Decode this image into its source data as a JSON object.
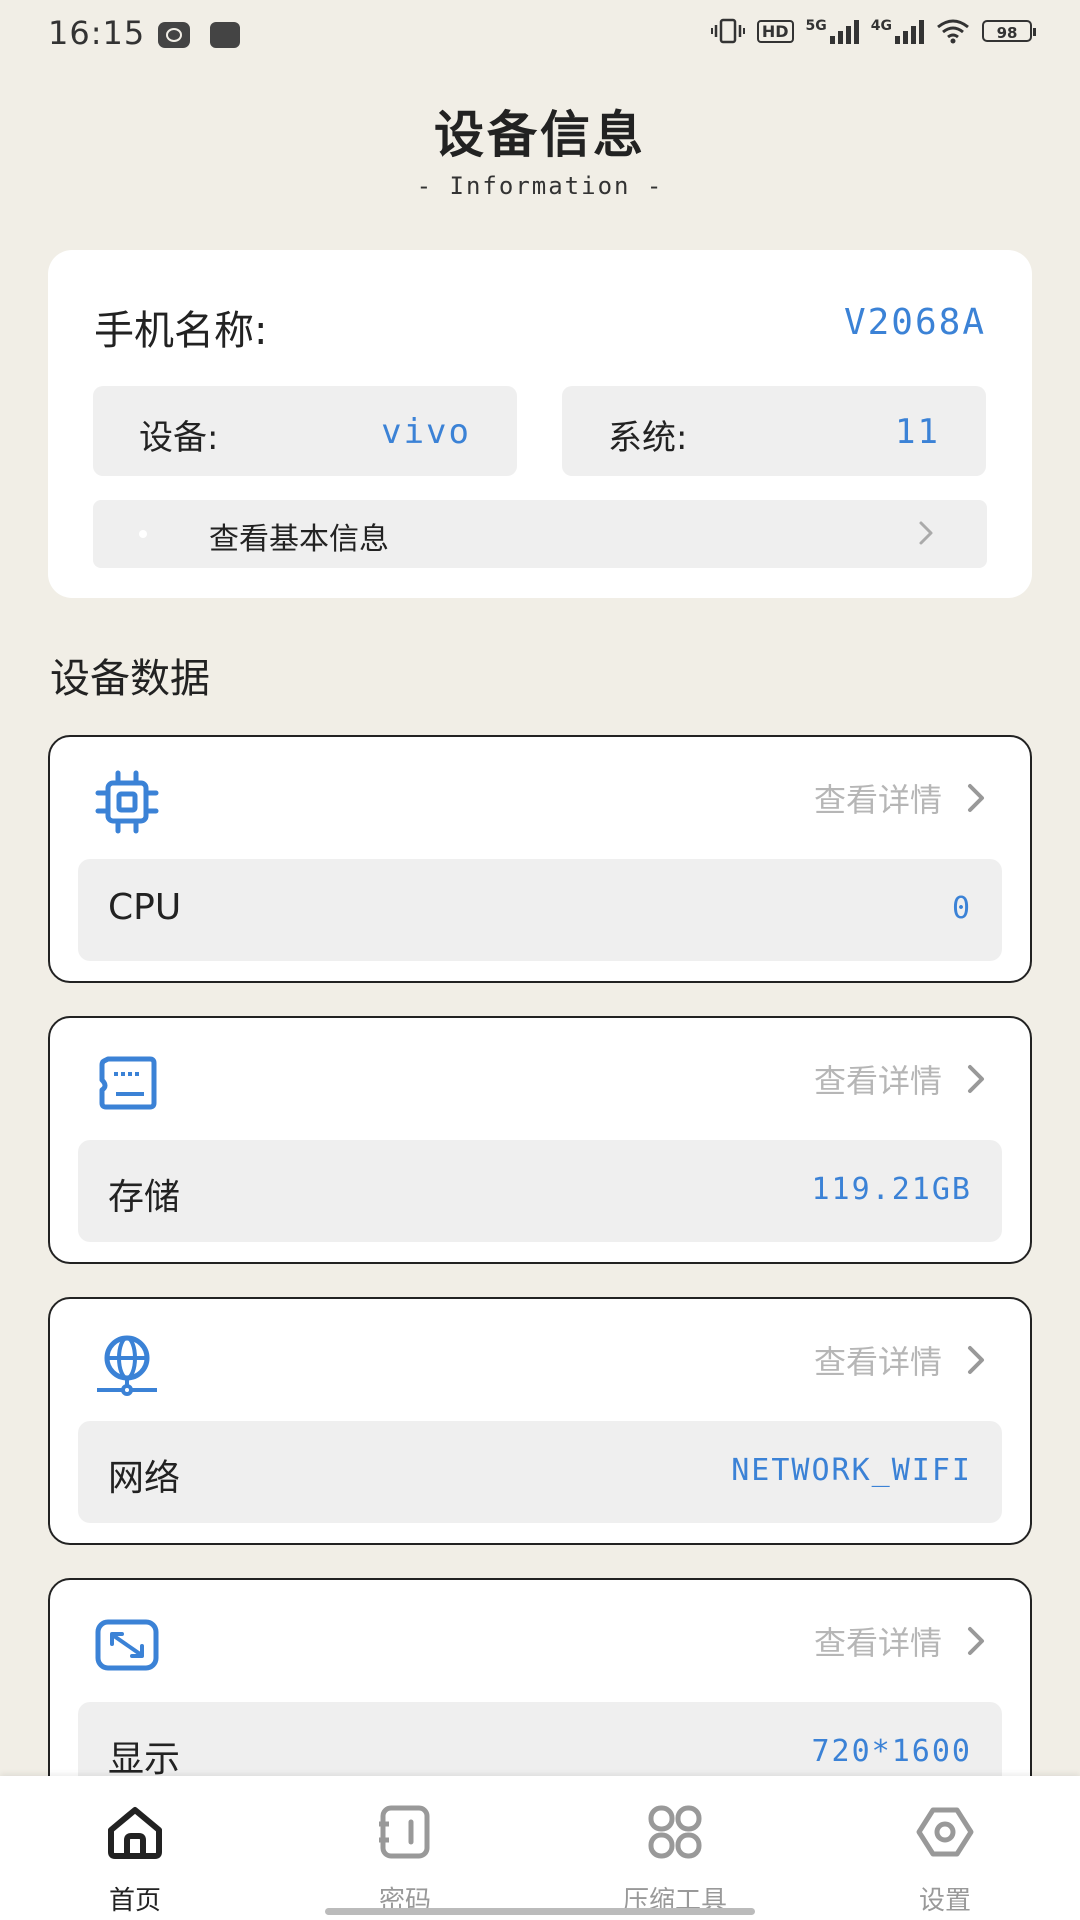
{
  "status_bar": {
    "time": "16:15",
    "hd_label": "HD",
    "net_5g": "5G",
    "net_4g": "4G",
    "battery": "98",
    "icons": [
      "notification-icon",
      "screen-record-icon",
      "vibrate-icon",
      "hd-voice-icon",
      "signal-5g-icon",
      "signal-4g-icon",
      "wifi-icon",
      "battery-icon"
    ]
  },
  "header": {
    "title": "设备信息",
    "subtitle": "- Information -"
  },
  "info_card": {
    "phone_name_label": "手机名称:",
    "phone_name_value": "V2068A",
    "device_label": "设备:",
    "device_value": "vivo",
    "system_label": "系统:",
    "system_value": "11",
    "basic_info_label": "查看基本信息"
  },
  "section": {
    "title": "设备数据"
  },
  "cards": [
    {
      "icon": "cpu-icon",
      "detail": "查看详情",
      "label": "CPU",
      "value": "0"
    },
    {
      "icon": "storage-card-icon",
      "detail": "查看详情",
      "label": "存储",
      "value": "119.21GB"
    },
    {
      "icon": "network-globe-icon",
      "detail": "查看详情",
      "label": "网络",
      "value": "NETWORK_WIFI"
    },
    {
      "icon": "display-resize-icon",
      "detail": "查看详情",
      "label": "显示",
      "value": "720*1600"
    }
  ],
  "nav": {
    "items": [
      {
        "label": "首页",
        "icon": "home-icon",
        "active": true
      },
      {
        "label": "密码",
        "icon": "password-icon",
        "active": false
      },
      {
        "label": "压缩工具",
        "icon": "compress-tools-icon",
        "active": false
      },
      {
        "label": "设置",
        "icon": "settings-icon",
        "active": false
      }
    ]
  },
  "colors": {
    "background": "#f1eee6",
    "accent": "#3b82d6",
    "muted": "#b6b6b6",
    "card": "#ffffff",
    "row": "#efefef"
  }
}
